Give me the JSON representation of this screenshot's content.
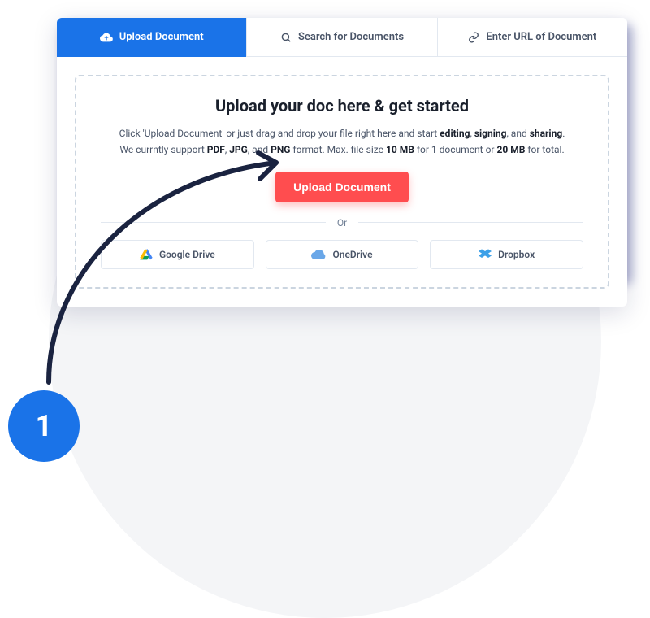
{
  "tabs": {
    "upload": "Upload Document",
    "search": "Search for Documents",
    "url": "Enter URL of Document"
  },
  "dropzone": {
    "title": "Upload your doc here & get started",
    "line1_pre": "Click 'Upload Document' or just drag and drop your file right here and start ",
    "b1": "editing",
    "sep1": ", ",
    "b2": "signing",
    "sep2": ", and ",
    "b3": "sharing",
    "post1": ".",
    "line2_pre": "We currntly support ",
    "f1": "PDF",
    "c1": ", ",
    "f2": "JPG",
    "c2": ", and ",
    "f3": "PNG",
    "line2_mid": " format. Max. file size ",
    "s1": "10 MB",
    "line2_mid2": " for 1 document or ",
    "s2": "20 MB",
    "line2_end": " for total.",
    "button": "Upload Document",
    "or": "Or"
  },
  "providers": {
    "gdrive": "Google Drive",
    "onedrive": "OneDrive",
    "dropbox": "Dropbox"
  },
  "step": "1"
}
